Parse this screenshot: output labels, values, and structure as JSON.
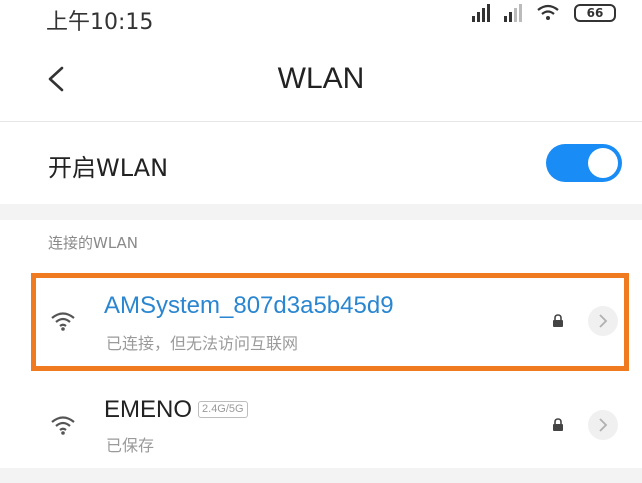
{
  "status_bar": {
    "time": "上午10:15",
    "battery": "66"
  },
  "header": {
    "title": "WLAN"
  },
  "wlan_toggle": {
    "label": "开启WLAN",
    "on": true,
    "color": "#1a8cf5"
  },
  "connected_section": {
    "header": "连接的WLAN"
  },
  "networks": [
    {
      "name": "AMSystem_807d3a5b45d9",
      "status": "已连接，但无法访问互联网",
      "name_color": "#2a86d0",
      "icon": "wifi-icon",
      "locked": true,
      "highlighted": true
    },
    {
      "name": "EMENO",
      "band": "2.4G/5G",
      "status": "已保存",
      "name_color": "#222222",
      "icon": "wifi-icon",
      "locked": true,
      "highlighted": false
    }
  ],
  "colors": {
    "highlight": "#f07a20",
    "accent": "#1a8cf5"
  }
}
